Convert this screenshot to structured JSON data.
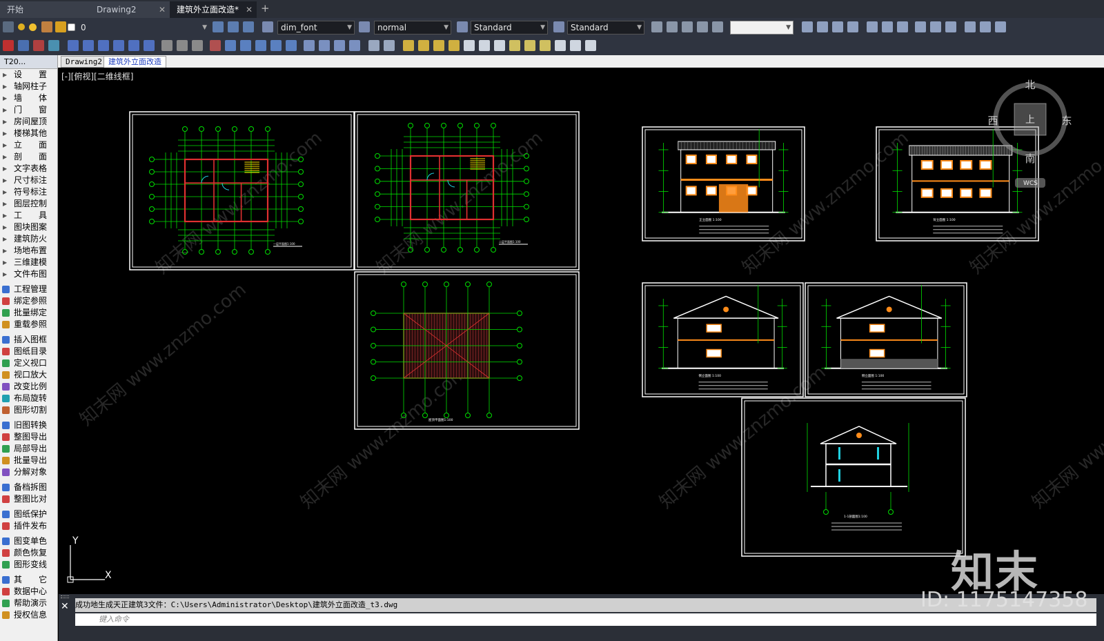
{
  "tabs": [
    {
      "label": "开始",
      "active": false,
      "closable": false
    },
    {
      "label": "Drawing2",
      "active": false,
      "closable": true
    },
    {
      "label": "建筑外立面改造*",
      "active": true,
      "closable": true
    }
  ],
  "tab_close_glyph": "✕",
  "new_tab_glyph": "+",
  "toolbar": {
    "layer_value": "0",
    "text_style": "dim_font",
    "dim_style": "normal",
    "table_style": "Standard",
    "multileader_style": "Standard",
    "blank_combo": ""
  },
  "doc_tabs": [
    {
      "label": "Drawing2",
      "active": false
    },
    {
      "label": "建筑外立面改造",
      "active": true
    }
  ],
  "left_panel": {
    "header": "T20...",
    "sections": [
      "设　　置",
      "轴网柱子",
      "墙　　体",
      "门　　窗",
      "房间屋顶",
      "楼梯其他",
      "立　　面",
      "剖　　面",
      "文字表格",
      "尺寸标注",
      "符号标注",
      "图层控制",
      "工　　具",
      "图块图案",
      "建筑防火",
      "场地布置",
      "三维建模",
      "文件布图"
    ],
    "group1": [
      "工程管理",
      "绑定参照",
      "批量绑定",
      "重载参照"
    ],
    "group2": [
      "插入图框",
      "图纸目录",
      "定义视口",
      "视口放大",
      "改变比例",
      "布局旋转",
      "图形切割"
    ],
    "group3": [
      "旧图转换",
      "整图导出",
      "局部导出",
      "批量导出",
      "分解对象"
    ],
    "group4": [
      "备档拆图",
      "整图比对"
    ],
    "group5": [
      "图纸保护",
      "插件发布"
    ],
    "group6": [
      "图变单色",
      "颜色恢复",
      "图形变线"
    ],
    "group7": [
      "其　　它",
      "数据中心",
      "帮助演示",
      "授权信息"
    ]
  },
  "canvas": {
    "view_label": "[-][俯视][二维线框]",
    "viewcube": {
      "north": "北",
      "south": "南",
      "east": "东",
      "west": "西",
      "top_face": "上",
      "wcs": "WCS"
    },
    "ucs": {
      "x": "X",
      "y": "Y"
    },
    "sheet_titles": {
      "plan1": "一层平面图1:100",
      "plan2": "二层平面图1:100",
      "roof": "屋顶平面图1:100",
      "front_elev": "正立面图 1:100",
      "back_elev": "背立面图 1:100",
      "left_elev": "侧立面图 1:100",
      "right_elev": "侧立面图 1:100",
      "section": "1-1剖面图1:100"
    },
    "watermark": "知末网 www.znzmo.com"
  },
  "command": {
    "history": "成功地生成天正建筑3文件：C:\\Users\\Administrator\\Desktop\\建筑外立面改造_t3.dwg",
    "placeholder": "键入命令"
  },
  "brand": "知末",
  "image_id": "ID: 1175147358",
  "colors": {
    "canvas_bg": "#000000",
    "line_white": "#ffffff",
    "line_green": "#00e000",
    "line_red": "#e03030",
    "line_orange": "#ff8c1a",
    "line_cyan": "#20d0e0",
    "line_yellow": "#ffe000"
  }
}
